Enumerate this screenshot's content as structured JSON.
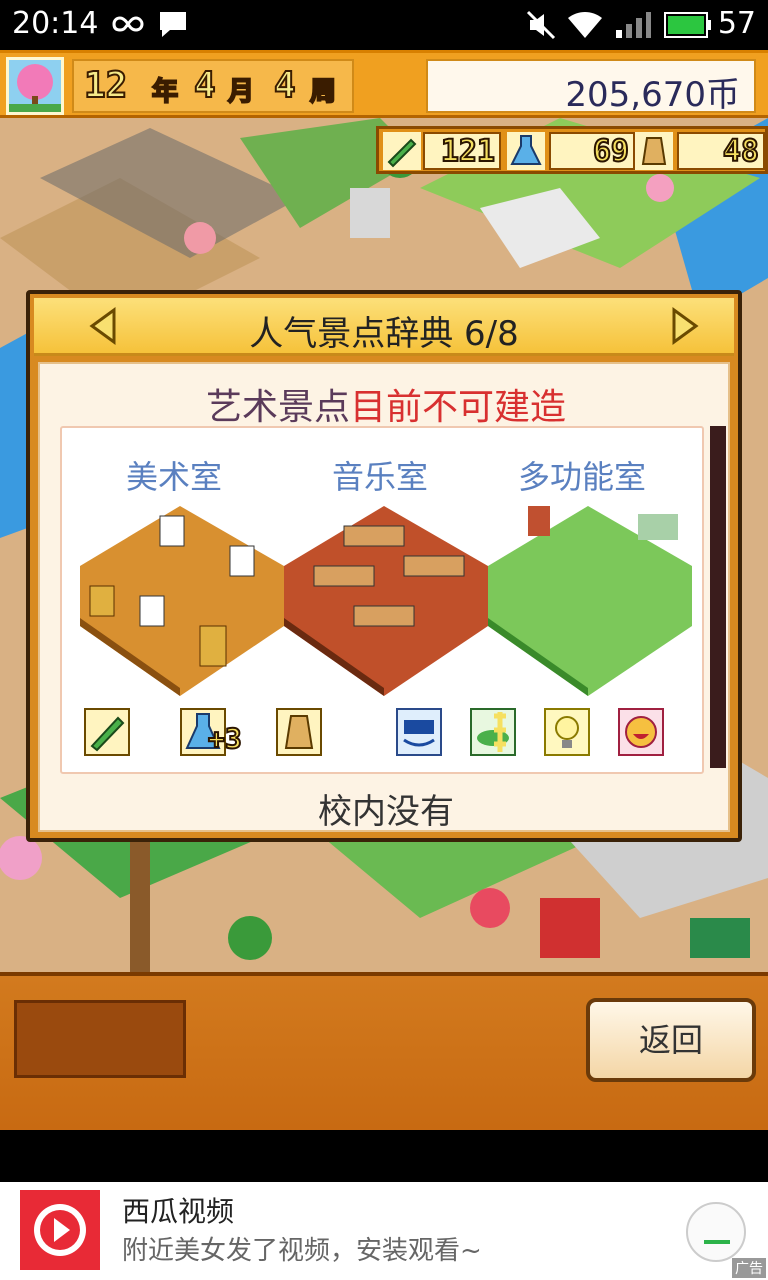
{
  "status_bar": {
    "time": "20:14",
    "battery": "57"
  },
  "hud": {
    "year_num": "12",
    "year_unit": "年",
    "month_num": "4",
    "month_unit": "月",
    "week_num": "4",
    "week_unit": "周",
    "money": "205,670币",
    "resources": {
      "pencil": "121",
      "flask": "69",
      "bell": "48"
    }
  },
  "dialog": {
    "title": "人气景点辞典 6/8",
    "category": "艺术景点",
    "status_warning": "目前不可建造",
    "rooms": [
      {
        "name": "美术室"
      },
      {
        "name": "音乐室"
      },
      {
        "name": "多功能室"
      }
    ],
    "requirement_bonus": "+3",
    "footer": "校内没有"
  },
  "bottom": {
    "back_label": "返回"
  },
  "ad": {
    "app_name": "西瓜视频",
    "tagline": "附近美女发了视频，安装观看~",
    "tag": "广告"
  },
  "colors": {
    "hud_orange": "#f0a020",
    "dialog_orange": "#d88a20",
    "room_name_blue": "#5a80c0",
    "warning_red": "#d83030",
    "ad_red": "#e82a36"
  }
}
